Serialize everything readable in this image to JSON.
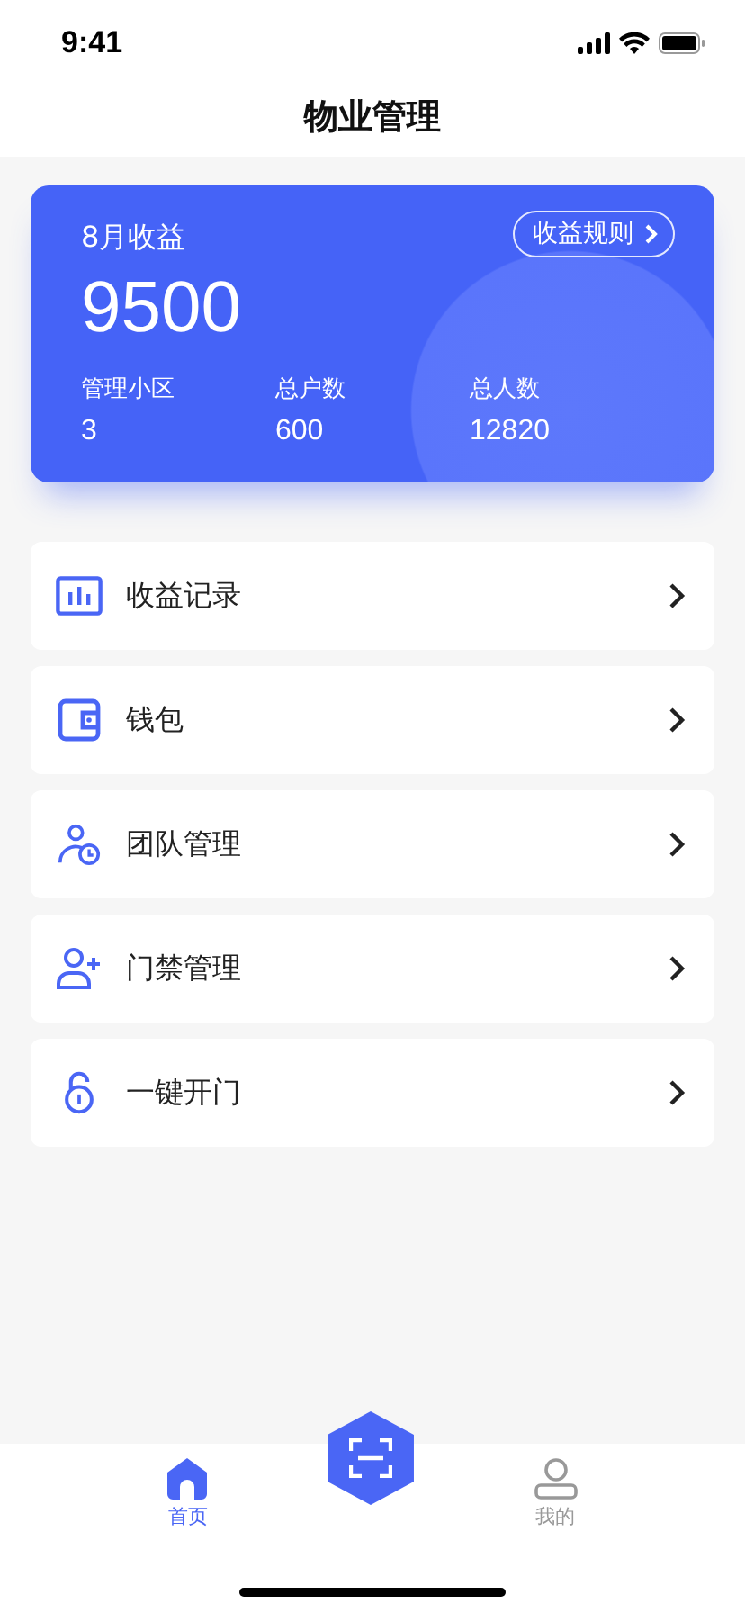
{
  "status_bar": {
    "time": "9:41"
  },
  "header": {
    "title": "物业管理"
  },
  "summary": {
    "title": "8月收益",
    "amount": "9500",
    "rules_button": "收益规则",
    "stats": [
      {
        "label": "管理小区",
        "value": "3"
      },
      {
        "label": "总户数",
        "value": "600"
      },
      {
        "label": "总人数",
        "value": "12820"
      }
    ]
  },
  "menu": [
    {
      "kind": "chart",
      "label": "收益记录"
    },
    {
      "kind": "wallet",
      "label": "钱包"
    },
    {
      "kind": "team",
      "label": "团队管理"
    },
    {
      "kind": "user-add",
      "label": "门禁管理"
    },
    {
      "kind": "lock",
      "label": "一键开门"
    }
  ],
  "tab_bar": [
    {
      "kind": "home",
      "label": "首页",
      "selected": true
    },
    {
      "kind": "scan",
      "selected": false
    },
    {
      "kind": "profile",
      "label": "我的",
      "selected": false
    }
  ]
}
